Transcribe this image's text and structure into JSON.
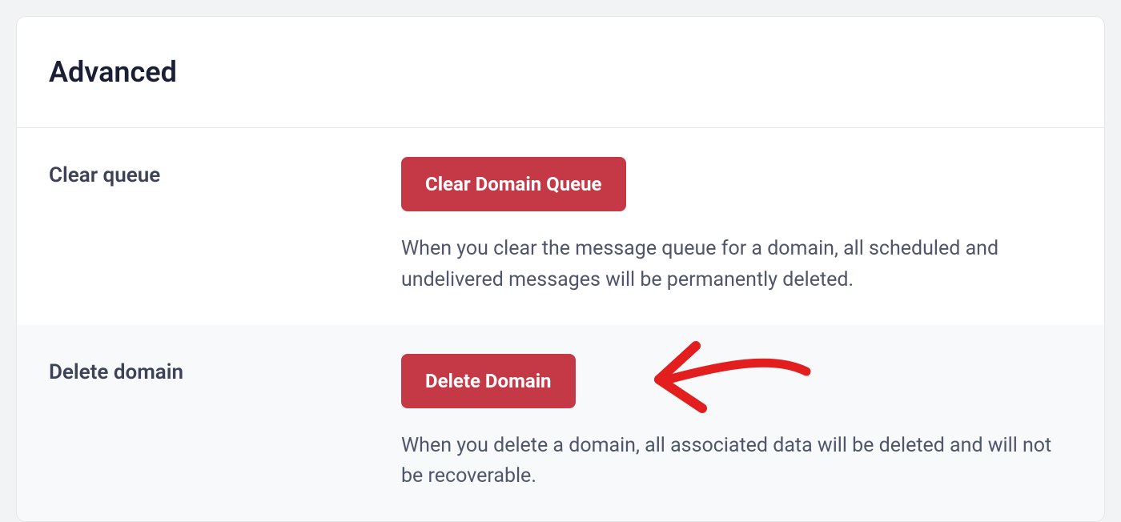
{
  "panel": {
    "title": "Advanced",
    "sections": {
      "clearQueue": {
        "label": "Clear queue",
        "buttonLabel": "Clear Domain Queue",
        "description": "When you clear the message queue for a domain, all scheduled and undelivered messages will be permanently deleted."
      },
      "deleteDomain": {
        "label": "Delete domain",
        "buttonLabel": "Delete Domain",
        "description": "When you delete a domain, all associated data will be deleted and will not be recoverable."
      }
    }
  },
  "colors": {
    "danger": "#c53846",
    "annotation": "#e31e1e"
  }
}
